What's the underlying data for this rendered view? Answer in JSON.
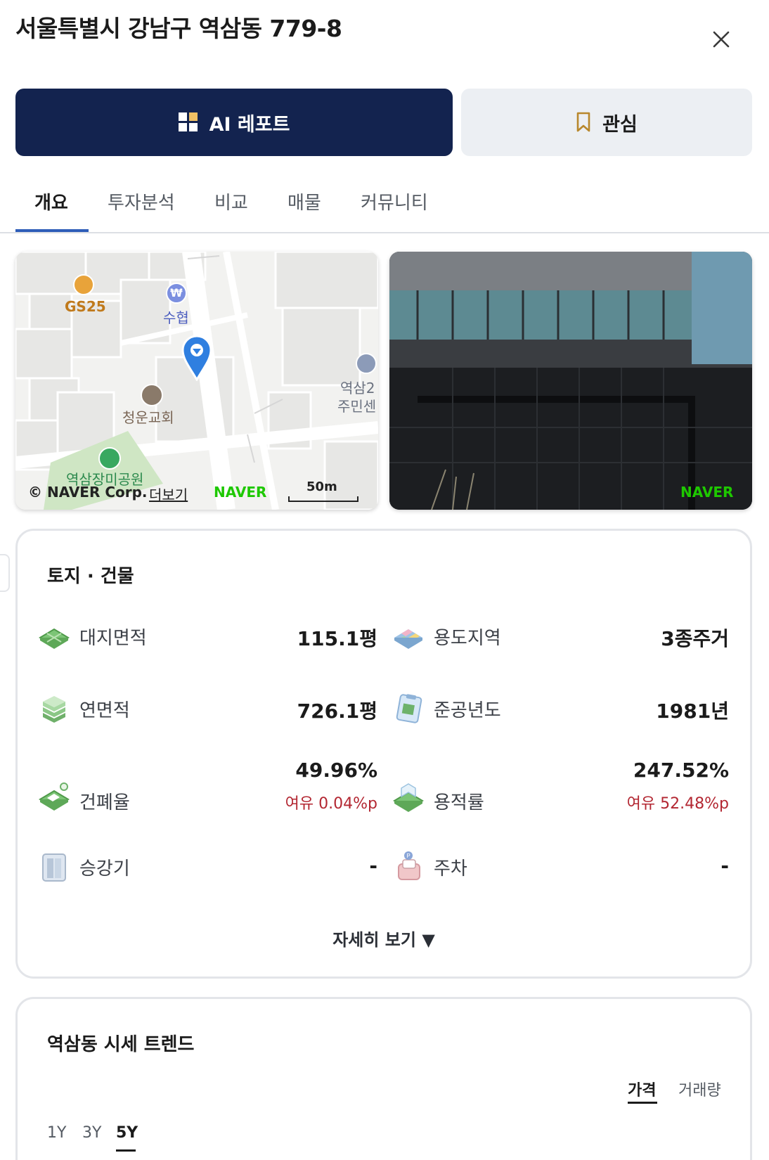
{
  "header": {
    "address": "서울특별시 강남구 역삼동 779-8"
  },
  "actions": {
    "ai_report_label": "AI 레포트",
    "favorite_label": "관심",
    "ai_button_color": "#13234f",
    "favorite_icon_color": "#b8872c"
  },
  "tabs": [
    "개요",
    "투자분석",
    "비교",
    "매물",
    "커뮤니티"
  ],
  "map": {
    "poi_gs25": "GS25",
    "poi_bank": "수협",
    "poi_church": "청운교회",
    "poi_park": "역삼장미공원",
    "poi_center_1": "역삼2",
    "poi_center_2": "주민센",
    "copyright": "© NAVER Corp.",
    "more_link": "더보기",
    "logo": "NAVER",
    "scale": "50m"
  },
  "photo": {
    "logo": "NAVER"
  },
  "land_building": {
    "title": "토지 · 건물",
    "items": [
      {
        "label": "대지면적",
        "value": "115.1평",
        "icon": "land-area-icon"
      },
      {
        "label": "용도지역",
        "value": "3종주거",
        "icon": "zoning-icon"
      },
      {
        "label": "연면적",
        "value": "726.1평",
        "icon": "floor-area-icon"
      },
      {
        "label": "준공년도",
        "value": "1981년",
        "icon": "completion-year-icon"
      },
      {
        "label": "건폐율",
        "value": "49.96%",
        "sub": "여유 0.04%p",
        "icon": "coverage-ratio-icon"
      },
      {
        "label": "용적률",
        "value": "247.52%",
        "sub": "여유 52.48%p",
        "icon": "floor-area-ratio-icon"
      },
      {
        "label": "승강기",
        "value": "-",
        "icon": "elevator-icon"
      },
      {
        "label": "주차",
        "value": "-",
        "icon": "parking-icon"
      }
    ],
    "more_label": "자세히 보기 ▼"
  },
  "trend": {
    "title": "역삼동 시세 트렌드",
    "metric_tabs": [
      "가격",
      "거래량"
    ],
    "active_metric": "가격",
    "period_tabs": [
      "1Y",
      "3Y",
      "5Y"
    ],
    "active_period": "5Y"
  }
}
